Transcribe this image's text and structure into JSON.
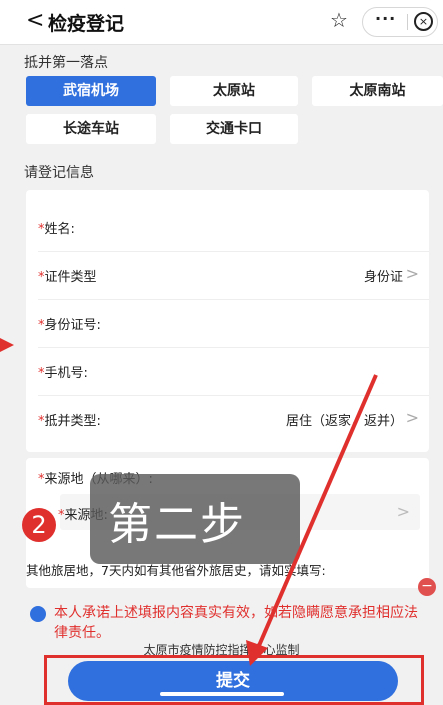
{
  "header": {
    "back_glyph": "<",
    "title": "检疫登记",
    "star_glyph": "☆",
    "more_glyph": "···",
    "close_glyph": "×"
  },
  "arrival": {
    "label": "抵并第一落点",
    "options": [
      "武宿机场",
      "太原站",
      "太原南站",
      "长途车站",
      "交通卡口"
    ],
    "selected": "武宿机场"
  },
  "register_label": "请登记信息",
  "form": {
    "name_label": "姓名:",
    "id_type_label": "证件类型",
    "id_type_value": "身份证",
    "id_number_label": "身份证号:",
    "phone_label": "手机号:",
    "entry_type_label": "抵并类型:",
    "entry_type_value": "居住（返家，返并）",
    "origin_label": "来源地（从哪来）:",
    "origin_sub_label": "来源地:",
    "other_places_label": "其他旅居地，7天内如有其他省外旅居史，请如实填写:"
  },
  "required_mark": "*",
  "chevron": ">",
  "overlay": {
    "step_number": "2",
    "step_text": "第二步"
  },
  "pledge": "本人承诺上述填报内容真实有效，如若隐瞒愿意承担相应法律责任。",
  "supervisor": "太原市疫情防控指挥中心监制",
  "submit_label": "提交",
  "minus_glyph": "−",
  "colors": {
    "accent": "#2f6fde",
    "annotation_red": "#e0302e"
  }
}
